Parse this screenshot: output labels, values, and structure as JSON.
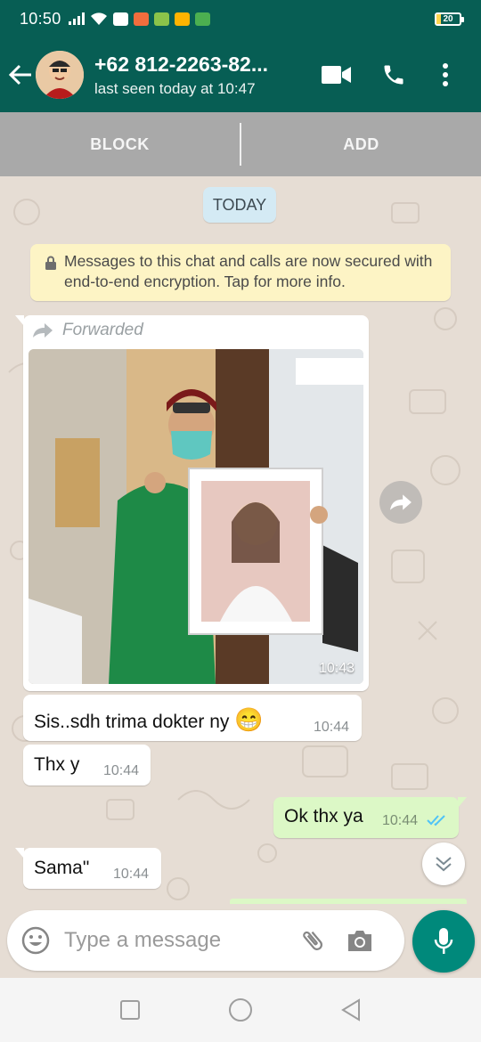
{
  "status_bar": {
    "time": "10:50",
    "battery": "20",
    "battery_level_percent": 20,
    "icons": [
      "signal-icon",
      "wifi-icon",
      "notification-icons",
      "battery-icon"
    ]
  },
  "header": {
    "contact_name": "+62 812-2263-82...",
    "last_seen": "last seen today at 10:47",
    "icons": [
      "back-arrow-icon",
      "video-call-icon",
      "phone-call-icon",
      "more-options-icon"
    ]
  },
  "actions": {
    "block_label": "BLOCK",
    "add_label": "ADD"
  },
  "chat": {
    "date_label": "TODAY",
    "encryption_notice": "Messages to this chat and calls are now secured with end-to-end encryption. Tap for more info.",
    "messages": [
      {
        "type": "image",
        "direction": "incoming",
        "forwarded_label": "Forwarded",
        "time": "10:43"
      },
      {
        "type": "text",
        "direction": "incoming",
        "text": "Sis..sdh trima dokter ny",
        "emoji": "😁",
        "time": "10:44"
      },
      {
        "type": "text",
        "direction": "incoming",
        "text": "Thx y",
        "time": "10:44"
      },
      {
        "type": "text",
        "direction": "outgoing",
        "text": "Ok thx ya",
        "time": "10:44",
        "status": "read"
      },
      {
        "type": "text",
        "direction": "incoming",
        "text": "Sama\"",
        "time": "10:44"
      }
    ]
  },
  "composer": {
    "placeholder": "Type a message",
    "icons": [
      "emoji-icon",
      "attach-icon",
      "camera-icon",
      "mic-icon"
    ]
  },
  "colors": {
    "header": "#075e54",
    "action_bar": "#a9a9a9",
    "chat_bg": "#e6ddd4",
    "incoming_bubble": "#ffffff",
    "outgoing_bubble": "#dcf8c6",
    "encryption_bg": "#fdf4c5",
    "date_chip": "#d4eaf4",
    "mic_button": "#00897b",
    "read_ticks": "#4fc3f7"
  }
}
